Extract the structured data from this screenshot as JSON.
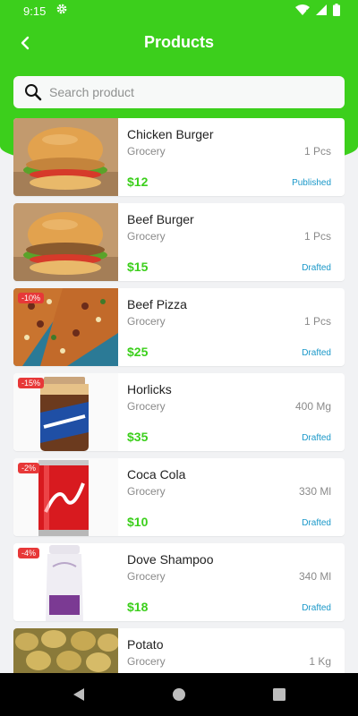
{
  "status_bar": {
    "time": "9:15"
  },
  "toolbar": {
    "title": "Products"
  },
  "search": {
    "placeholder": "Search product"
  },
  "colors": {
    "accent": "#3ccf1c",
    "status": "#1a98c9",
    "discount": "#e73838"
  },
  "products": [
    {
      "name": "Chicken Burger",
      "category": "Grocery",
      "quantity": "1 Pcs",
      "price": "$12",
      "status": "Published",
      "discount": ""
    },
    {
      "name": "Beef Burger",
      "category": "Grocery",
      "quantity": "1 Pcs",
      "price": "$15",
      "status": "Drafted",
      "discount": ""
    },
    {
      "name": "Beef Pizza",
      "category": "Grocery",
      "quantity": "1 Pcs",
      "price": "$25",
      "status": "Drafted",
      "discount": "-10%"
    },
    {
      "name": "Horlicks",
      "category": "Grocery",
      "quantity": "400 Mg",
      "price": "$35",
      "status": "Drafted",
      "discount": "-15%"
    },
    {
      "name": "Coca Cola",
      "category": "Grocery",
      "quantity": "330 Ml",
      "price": "$10",
      "status": "Drafted",
      "discount": "-2%"
    },
    {
      "name": "Dove Shampoo",
      "category": "Grocery",
      "quantity": "340 Ml",
      "price": "$18",
      "status": "Drafted",
      "discount": "-4%"
    },
    {
      "name": "Potato",
      "category": "Grocery",
      "quantity": "1 Kg",
      "price": "",
      "status": "",
      "discount": ""
    }
  ]
}
